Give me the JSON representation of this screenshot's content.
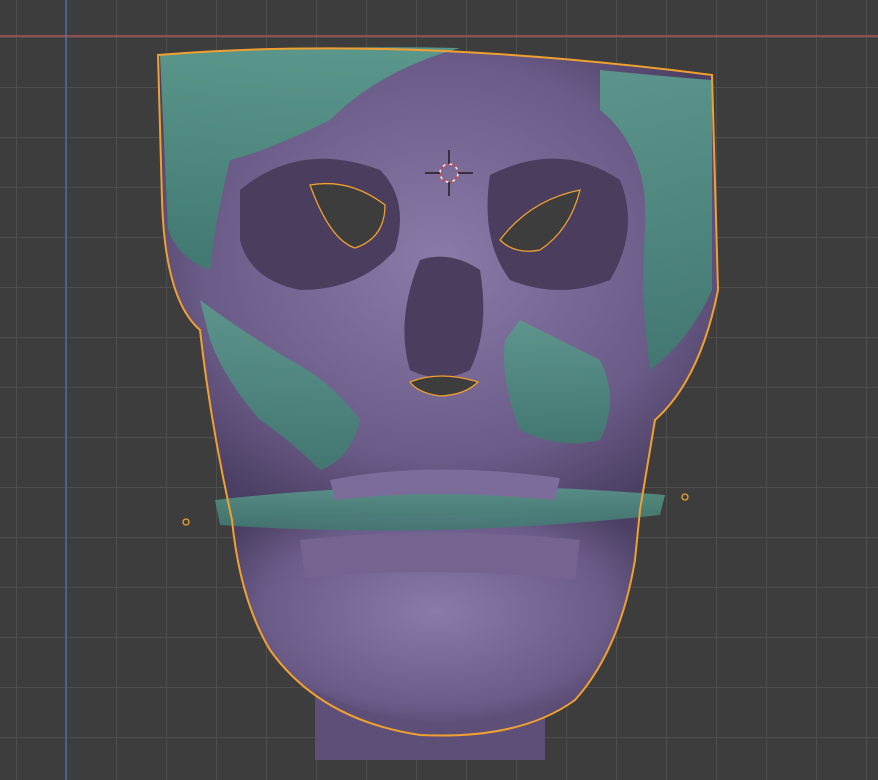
{
  "viewport": {
    "background_color": "#3d3d3d",
    "grid_color": "#505050",
    "x_axis_color": "#c65a5a",
    "y_axis_color": "#4a78b8",
    "selection_outline_color": "#f0a030",
    "bone_color": "#6e5e8c",
    "overlay_color": "#4f8c80",
    "cursor_icon": "3d-cursor-icon"
  },
  "model": {
    "selected": true
  }
}
